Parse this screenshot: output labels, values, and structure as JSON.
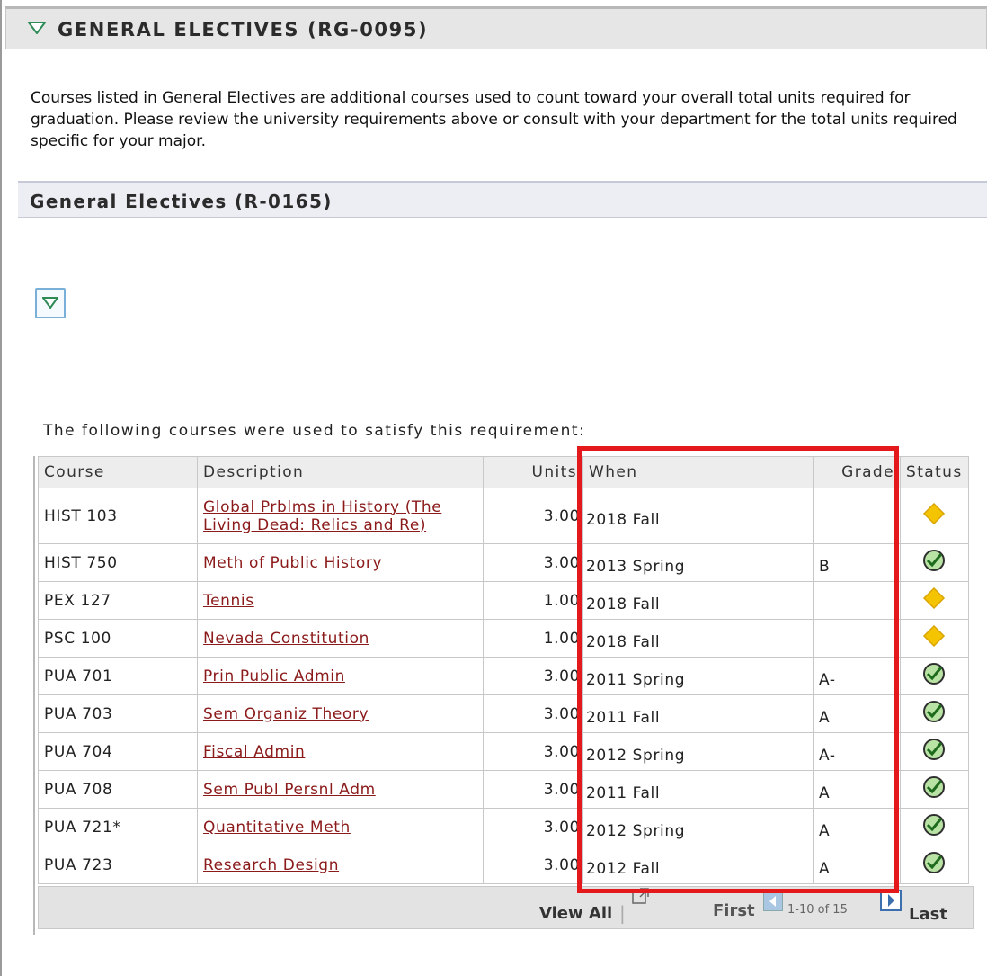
{
  "group": {
    "title": "GENERAL ELECTIVES (RG-0095)"
  },
  "intro": "Courses listed in General Electives are additional courses used to count toward your overall total units required for graduation. Please review the university requirements above or consult with your department for the total units required specific for your major.",
  "requirement": {
    "title": "General Electives (R-0165)"
  },
  "used_text": "The following courses were used to satisfy this requirement:",
  "columns": {
    "course": "Course",
    "description": "Description",
    "units": "Units",
    "when": "When",
    "grade": "Grade",
    "status": "Status"
  },
  "rows": [
    {
      "course": "HIST 103",
      "description": "Global Prblms in History (The Living Dead: Relics and Re)",
      "units": "3.00",
      "when": "2018 Fall",
      "grade": "",
      "status": "in-progress"
    },
    {
      "course": "HIST 750",
      "description": "Meth of Public History",
      "units": "3.00",
      "when": "2013 Spring",
      "grade": "B",
      "status": "taken"
    },
    {
      "course": "PEX 127",
      "description": "Tennis",
      "units": "1.00",
      "when": "2018 Fall",
      "grade": "",
      "status": "in-progress"
    },
    {
      "course": "PSC 100",
      "description": "Nevada Constitution",
      "units": "1.00",
      "when": "2018 Fall",
      "grade": "",
      "status": "in-progress"
    },
    {
      "course": "PUA 701",
      "description": "Prin Public Admin",
      "units": "3.00",
      "when": "2011 Spring",
      "grade": "A-",
      "status": "taken"
    },
    {
      "course": "PUA 703",
      "description": "Sem Organiz Theory",
      "units": "3.00",
      "when": "2011 Fall",
      "grade": "A",
      "status": "taken"
    },
    {
      "course": "PUA 704",
      "description": "Fiscal Admin",
      "units": "3.00",
      "when": "2012 Spring",
      "grade": "A-",
      "status": "taken"
    },
    {
      "course": "PUA 708",
      "description": "Sem Publ Persnl Adm",
      "units": "3.00",
      "when": "2011 Fall",
      "grade": "A",
      "status": "taken"
    },
    {
      "course": "PUA 721*",
      "description": "Quantitative Meth",
      "units": "3.00",
      "when": "2012 Spring",
      "grade": "A",
      "status": "taken"
    },
    {
      "course": "PUA 723",
      "description": "Research Design",
      "units": "3.00",
      "when": "2012 Fall",
      "grade": "A",
      "status": "taken"
    }
  ],
  "footer": {
    "view_all": "View All",
    "first": "First",
    "range": "1-10 of 15",
    "last": "Last"
  },
  "icons": {
    "in_progress": "diamond-icon",
    "taken": "check-circle-icon"
  },
  "colors": {
    "link": "#8b1a1a",
    "highlight": "#e3191b",
    "diamond": "#f5c400",
    "check": "#3aa33a"
  }
}
